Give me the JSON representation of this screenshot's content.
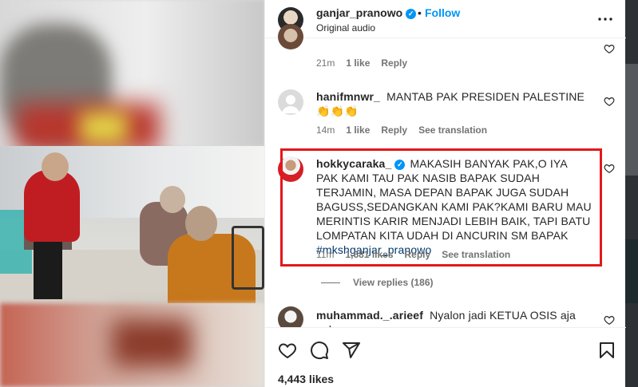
{
  "post": {
    "username": "ganjar_pranowo",
    "separator": "•",
    "follow_label": "Follow",
    "audio": "Original audio",
    "likes": "4,443 likes"
  },
  "comments": [
    {
      "meta_time": "21m",
      "meta_likes": "1 like",
      "reply_label": "Reply"
    },
    {
      "username": "hanifmnwr_",
      "text": "MANTAB PAK PRESIDEN PALESTINE👏👏👏",
      "meta_time": "14m",
      "meta_likes": "1 like",
      "reply_label": "Reply",
      "translate_label": "See translation"
    },
    {
      "username": "hokkycaraka_",
      "text": "MAKASIH BANYAK PAK,O IYA PAK KAMI TAU PAK NASIB BAPAK SUDAH TERJAMIN, MASA DEPAN BAPAK JUGA SUDAH BAGUSS,SEDANGKAN KAMI PAK?KAMI BARU MAU MERINTIS KARIR MENJADI LEBIH BAIK, TAPI BATU LOMPATAN KITA UDAH DI ANCURIN SM BAPAK ",
      "hashtag": "#mkshganjar_pranowo",
      "meta_time": "11m",
      "meta_likes": "1,681 likes",
      "reply_label": "Reply",
      "translate_label": "See translation",
      "view_replies": "View replies (186)"
    },
    {
      "username": "muhammad._.arieef",
      "text": "Nyalon jadi KETUA OSIS aja pak"
    }
  ],
  "icons": {
    "verified": "verified-badge-icon",
    "more": "more-options-icon",
    "heart": "heart-icon",
    "comment": "comment-icon",
    "share": "share-icon",
    "save": "bookmark-icon"
  },
  "colors": {
    "accent": "#0095f6",
    "highlight": "#e3171c",
    "muted": "#737373",
    "link": "#00376b"
  }
}
